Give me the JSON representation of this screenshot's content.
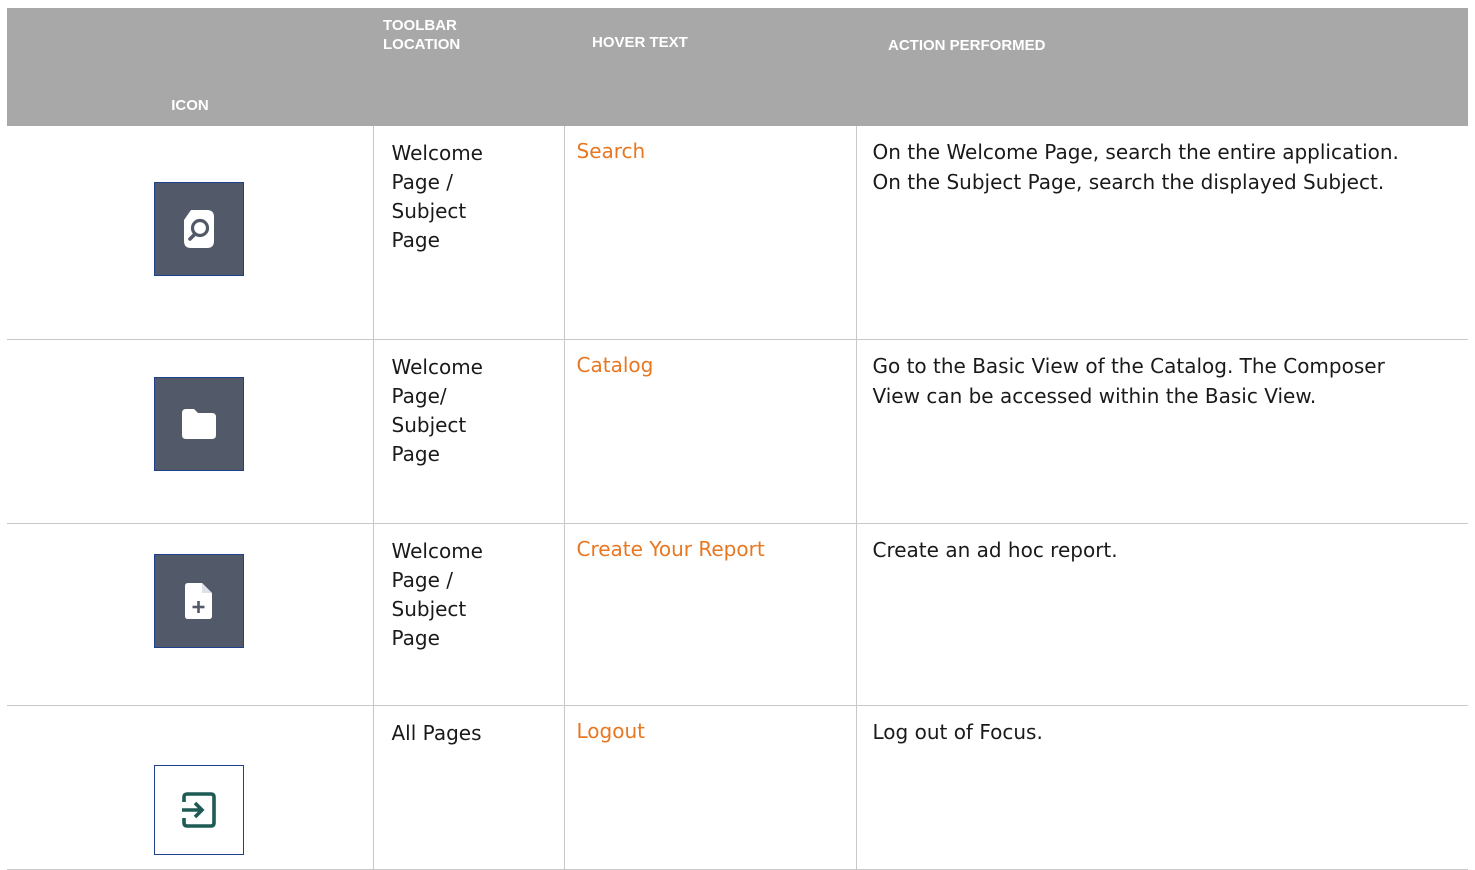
{
  "table": {
    "headers": {
      "icon": "ICON",
      "location": [
        "TOOLBAR",
        "LOCATION"
      ],
      "hover": "HOVER TEXT",
      "action": "ACTION PERFORMED"
    },
    "rows": [
      {
        "icon": "search-icon",
        "location": [
          "Welcome",
          "Page /",
          "Subject",
          "Page"
        ],
        "hover": "Search",
        "action": "On the Welcome Page, search the entire application. On the Subject Page, search the displayed Subject."
      },
      {
        "icon": "folder-icon",
        "location": [
          "Welcome",
          "Page/",
          "Subject",
          "Page"
        ],
        "hover": "Catalog",
        "action": "Go to the Basic View of the Catalog. The Composer View can be accessed within the Basic View."
      },
      {
        "icon": "add-file-icon",
        "location": [
          "Welcome",
          "Page /",
          "Subject",
          "Page"
        ],
        "hover": "Create Your Report",
        "action": "Create an ad hoc report."
      },
      {
        "icon": "logout-icon",
        "location": [
          "All Pages"
        ],
        "hover": "Logout",
        "action": "Log out of Focus."
      }
    ]
  },
  "colors": {
    "header_bg": "#a8a8a8",
    "hover_text": "#e87722",
    "icon_bg": "#525968",
    "logout_icon": "#1f5a55"
  }
}
